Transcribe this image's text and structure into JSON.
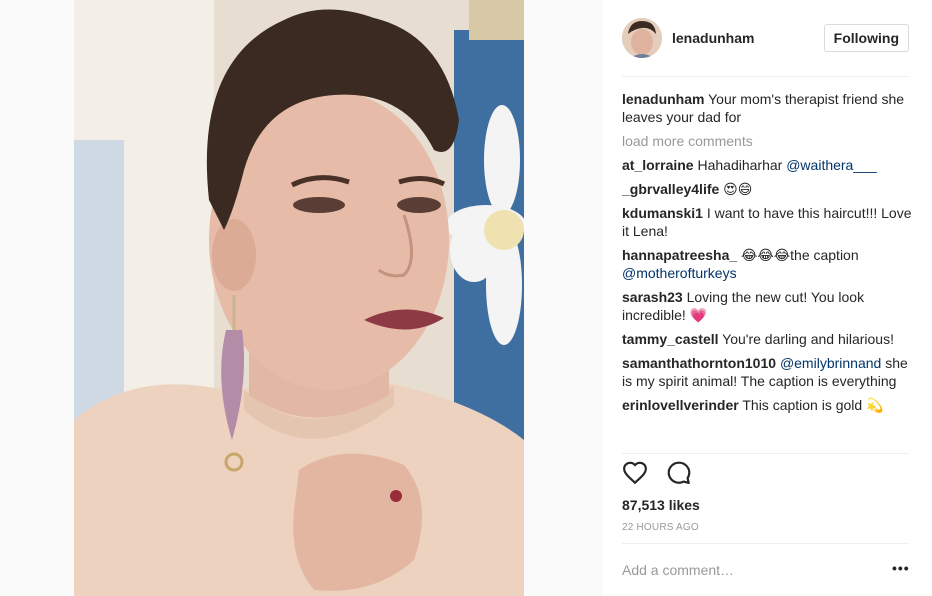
{
  "post": {
    "username": "lenadunham",
    "follow_label": "Following",
    "caption_user": "lenadunham",
    "caption_text": " Your mom's therapist friend she leaves your dad for",
    "load_more": "load more comments",
    "likes": "87,513 likes",
    "time": "22 HOURS AGO",
    "add_comment_placeholder": "Add a comment…",
    "more_label": "•••"
  },
  "comments": [
    {
      "user": "at_lorraine",
      "text": " Hahadiharhar ",
      "mention": "@waithera___",
      "after": ""
    },
    {
      "user": "_gbrvalley4life",
      "text": " 😍😄",
      "mention": "",
      "after": ""
    },
    {
      "user": "kdumanski1",
      "text": " I want to have this haircut!!! Love it Lena!",
      "mention": "",
      "after": ""
    },
    {
      "user": "hannapatreesha_",
      "text": " 😂😂😂the caption ",
      "mention": "@motherofturkeys",
      "after": ""
    },
    {
      "user": "sarash23",
      "text": " Loving the new cut! You look incredible! 💗",
      "mention": "",
      "after": ""
    },
    {
      "user": "tammy_castell",
      "text": " You're darling and hilarious!",
      "mention": "",
      "after": ""
    },
    {
      "user": "samanthathornton1010",
      "text": " ",
      "mention": "@emilybrinnand",
      "after": " she is my spirit animal! The caption is everything"
    },
    {
      "user": "erinlovellverinder",
      "text": " This caption is gold 💫",
      "mention": "",
      "after": ""
    }
  ],
  "icons": {
    "like": "heart-icon",
    "comment": "comment-icon"
  },
  "colors": {
    "mention": "#003569",
    "muted": "#999999",
    "text": "#262626"
  }
}
